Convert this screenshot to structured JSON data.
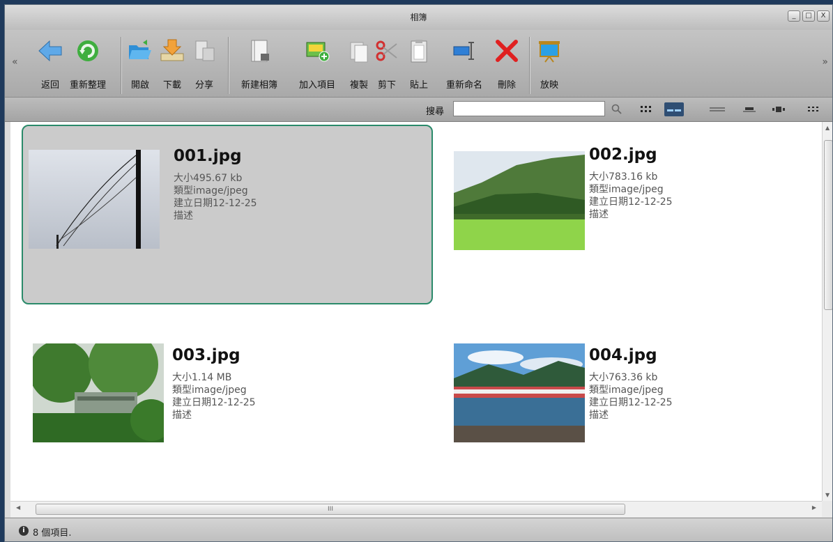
{
  "window": {
    "title": "相簿",
    "controls": {
      "minimize": "_",
      "maximize": "□",
      "close": "X"
    }
  },
  "toolbar": {
    "left_arrow": "«",
    "right_arrow": "»",
    "buttons": [
      {
        "label": "返回",
        "icon": "back-arrow-icon"
      },
      {
        "label": "重新整理",
        "icon": "refresh-icon"
      },
      {
        "label": "開啟",
        "icon": "open-folder-icon"
      },
      {
        "label": "下載",
        "icon": "download-icon"
      },
      {
        "label": "分享",
        "icon": "share-icon"
      },
      {
        "label": "新建相簿",
        "icon": "new-album-icon"
      },
      {
        "label": "加入項目",
        "icon": "add-item-icon"
      },
      {
        "label": "複製",
        "icon": "copy-icon"
      },
      {
        "label": "剪下",
        "icon": "scissors-icon"
      },
      {
        "label": "貼上",
        "icon": "paste-icon"
      },
      {
        "label": "重新命名",
        "icon": "rename-icon"
      },
      {
        "label": "刪除",
        "icon": "delete-x-icon"
      },
      {
        "label": "放映",
        "icon": "slideshow-icon"
      }
    ]
  },
  "search": {
    "label": "搜尋",
    "value": "",
    "placeholder": ""
  },
  "view_modes": [
    "large-icons-view-icon",
    "tiles-view-icon",
    "list-view-icon",
    "details-view-icon",
    "filmstrip-view-icon",
    "small-icons-view-icon"
  ],
  "files": [
    {
      "name": "001.jpg",
      "size": "大小495.67 kb",
      "type": "類型image/jpeg",
      "created": "建立日期12-12-25",
      "desc": "描述"
    },
    {
      "name": "002.jpg",
      "size": "大小783.16 kb",
      "type": "類型image/jpeg",
      "created": "建立日期12-12-25",
      "desc": "描述"
    },
    {
      "name": "003.jpg",
      "size": "大小1.14 MB",
      "type": "類型image/jpeg",
      "created": "建立日期12-12-25",
      "desc": "描述"
    },
    {
      "name": "004.jpg",
      "size": "大小763.36 kb",
      "type": "類型image/jpeg",
      "created": "建立日期12-12-25",
      "desc": "描述"
    }
  ],
  "hscroll_grip": "III",
  "status": {
    "icon": "i",
    "text": "8 個項目."
  },
  "colors": {
    "selection_border": "#2a8a6a",
    "selection_fill": "#cbcbcb",
    "active_view": "#2f4e73"
  }
}
